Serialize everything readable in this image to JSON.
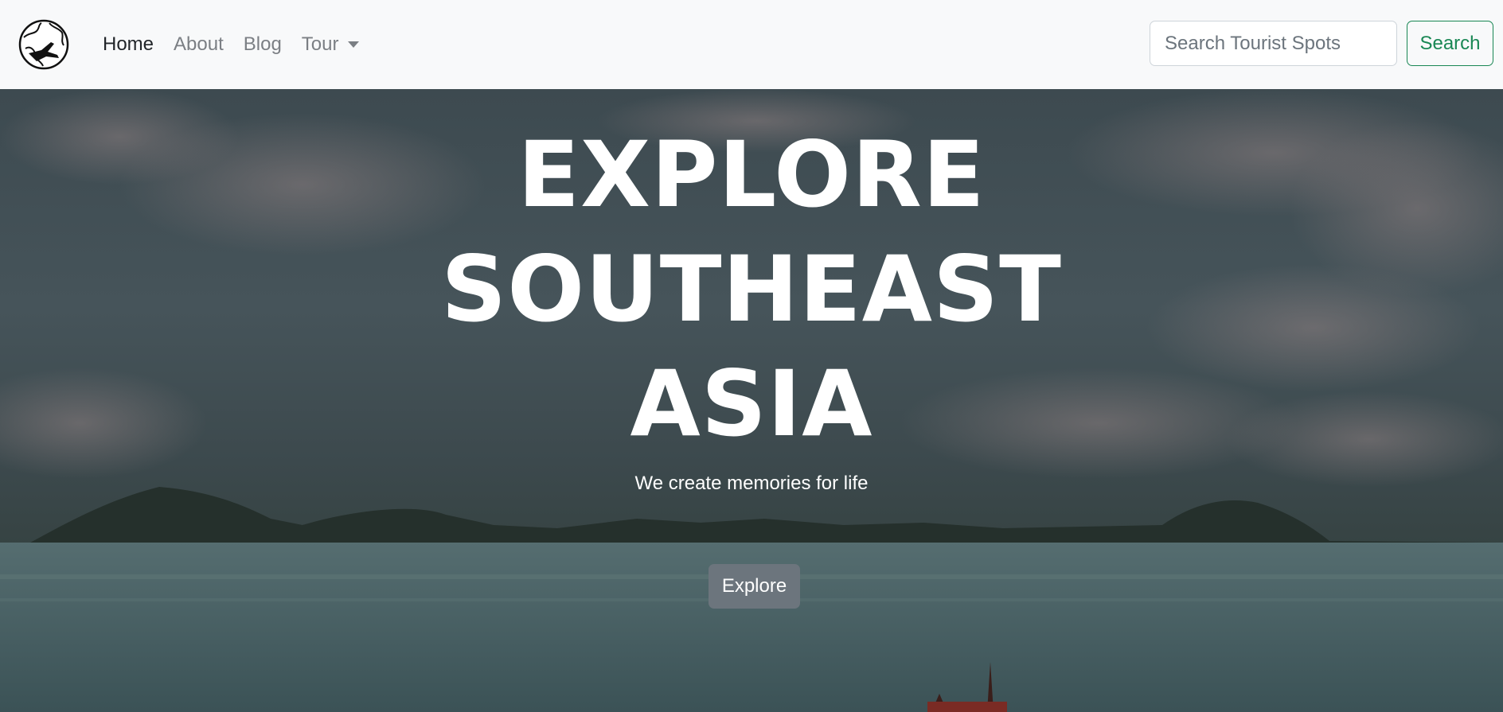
{
  "navbar": {
    "logo_icon": "globe-airplane-logo-icon",
    "links": [
      {
        "label": "Home",
        "active": true
      },
      {
        "label": "About",
        "active": false
      },
      {
        "label": "Blog",
        "active": false
      },
      {
        "label": "Tour",
        "active": false,
        "dropdown": true
      }
    ],
    "search": {
      "placeholder": "Search Tourist Spots",
      "value": "",
      "button_label": "Search"
    }
  },
  "hero": {
    "title_lines": [
      "EXPLORE",
      "SOUTHEAST",
      "ASIA"
    ],
    "subtitle": "We create memories for life",
    "cta_label": "Explore"
  },
  "colors": {
    "navbar_bg": "#f8f9fa",
    "active_link": "#212529",
    "inactive_link": "#7b7f84",
    "search_button": "#198754",
    "cta_button": "#6c757d",
    "hero_text": "#ffffff"
  }
}
